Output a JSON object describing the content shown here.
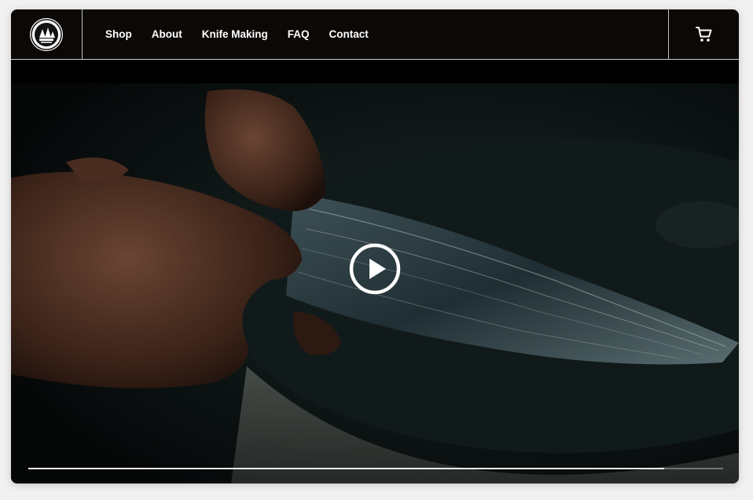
{
  "site": {
    "logo": {
      "text": "TAKEFU Knife Village"
    }
  },
  "nav": {
    "items": [
      {
        "label": "Shop",
        "id": "shop"
      },
      {
        "label": "About",
        "id": "about"
      },
      {
        "label": "Knife Making",
        "id": "knife-making"
      },
      {
        "label": "FAQ",
        "id": "faq"
      },
      {
        "label": "Contact",
        "id": "contact"
      }
    ]
  },
  "icons": {
    "cart": "cart-icon",
    "play": "play-icon"
  },
  "video": {
    "progress": 0.915
  },
  "colors": {
    "header_bg": "#0b0806",
    "nav_text": "#ffffff",
    "divider": "#c8c8c8"
  }
}
